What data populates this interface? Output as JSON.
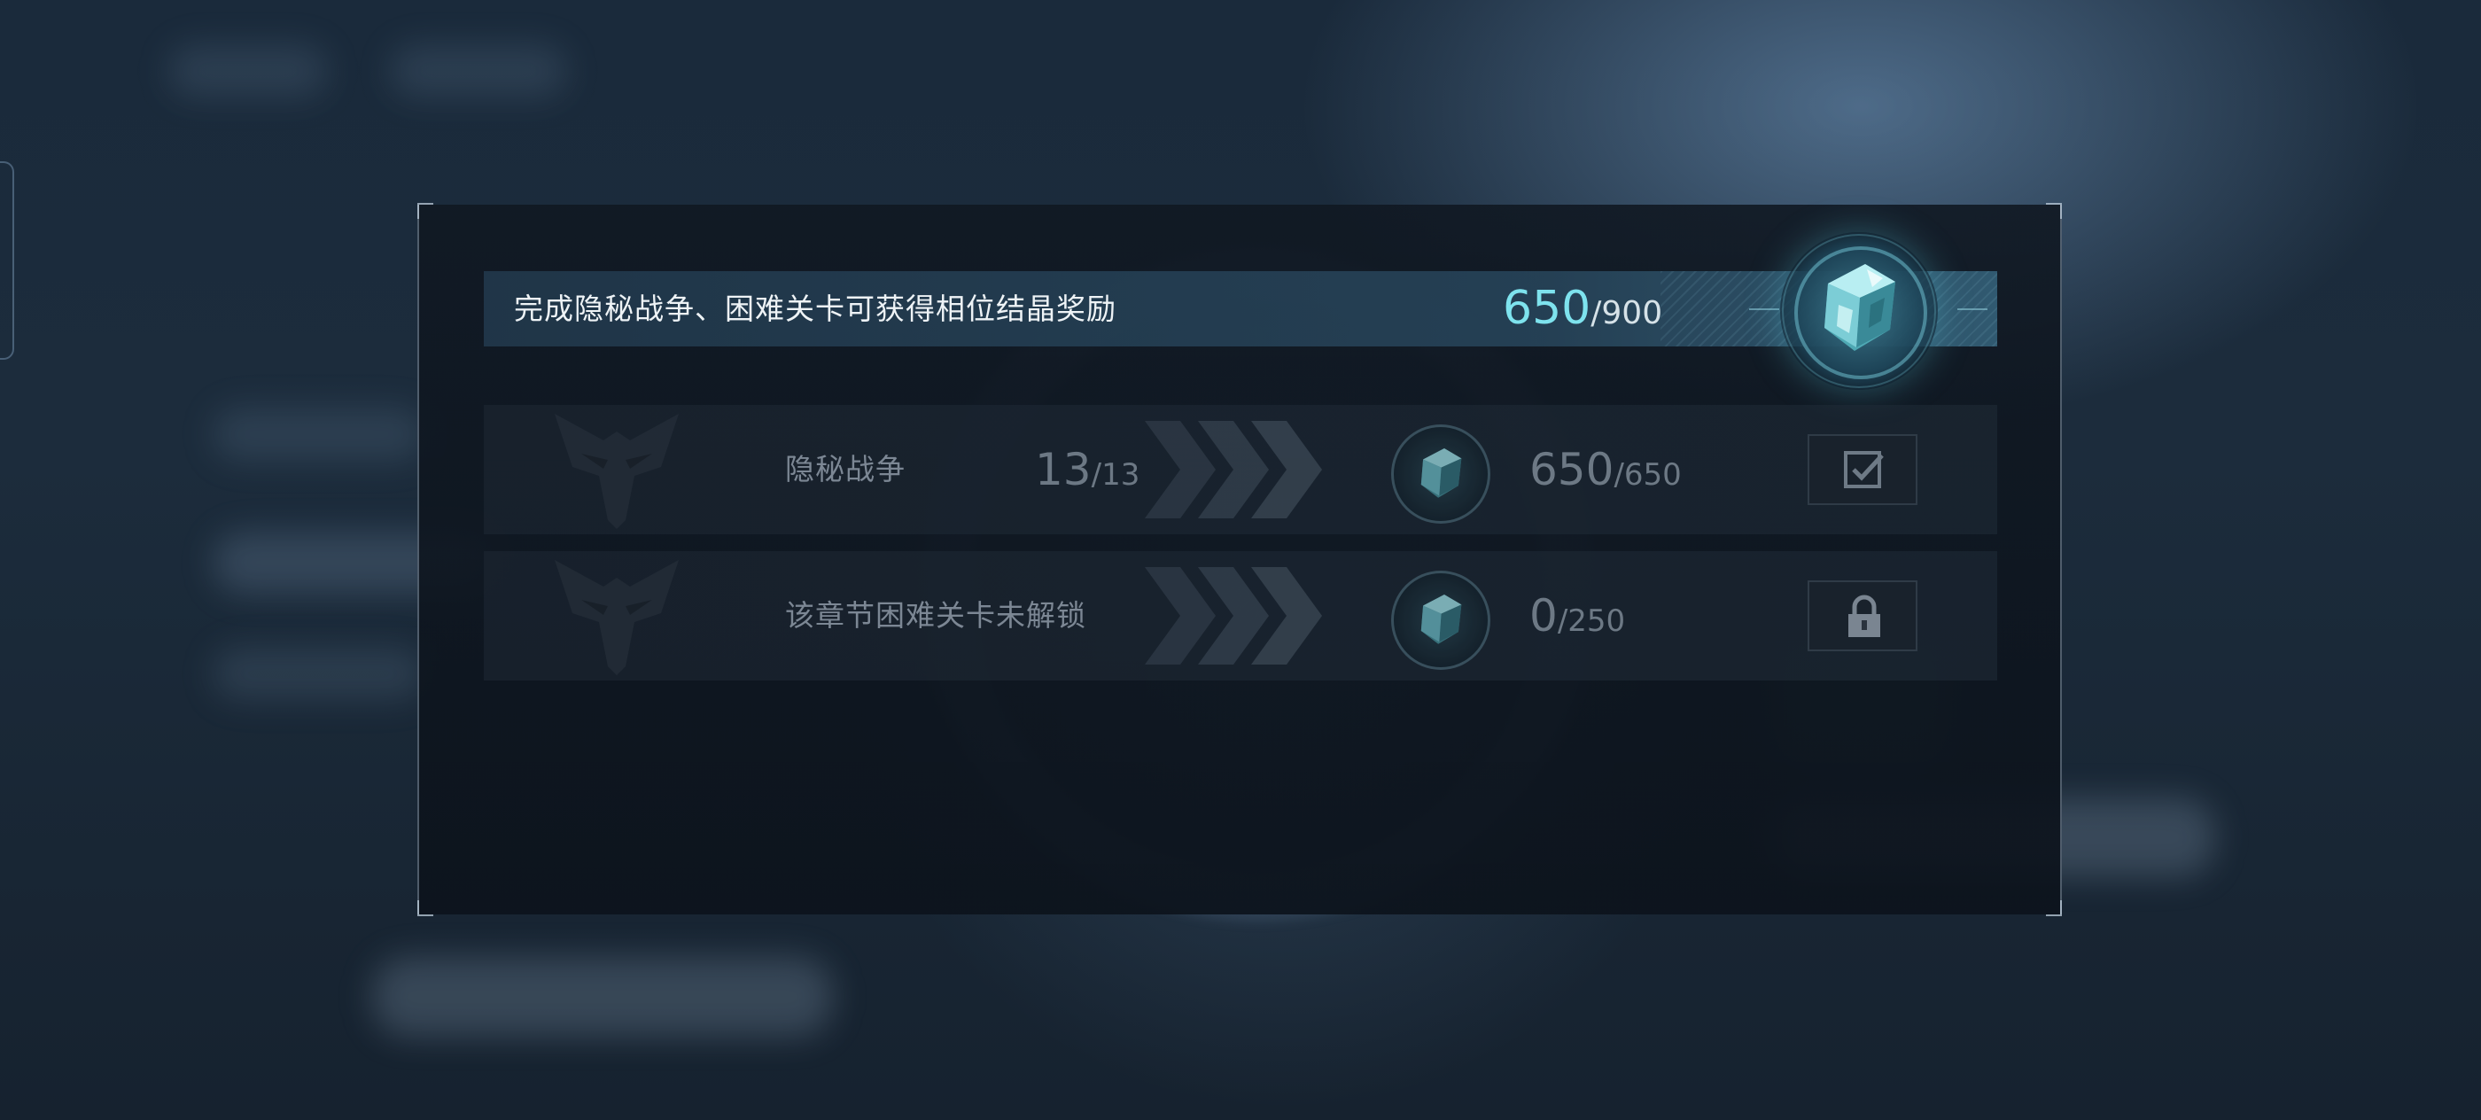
{
  "header": {
    "description": "完成隐秘战争、困难关卡可获得相位结晶奖励",
    "progress_current": "650",
    "progress_total": "/900",
    "reward_icon": "crystal-icon"
  },
  "rows": [
    {
      "title": "隐秘战争",
      "count_current": "13",
      "count_total": "/13",
      "reward_current": "650",
      "reward_total": "/650",
      "status_icon": "checkbox-checked-icon"
    },
    {
      "title": "该章节困难关卡未解锁",
      "count_current": "",
      "count_total": "",
      "reward_current": "0",
      "reward_total": "/250",
      "status_icon": "lock-icon"
    }
  ],
  "colors": {
    "accent": "#7ee3ee",
    "header_text": "#eef3f6",
    "dim_text": "#7c8794"
  }
}
